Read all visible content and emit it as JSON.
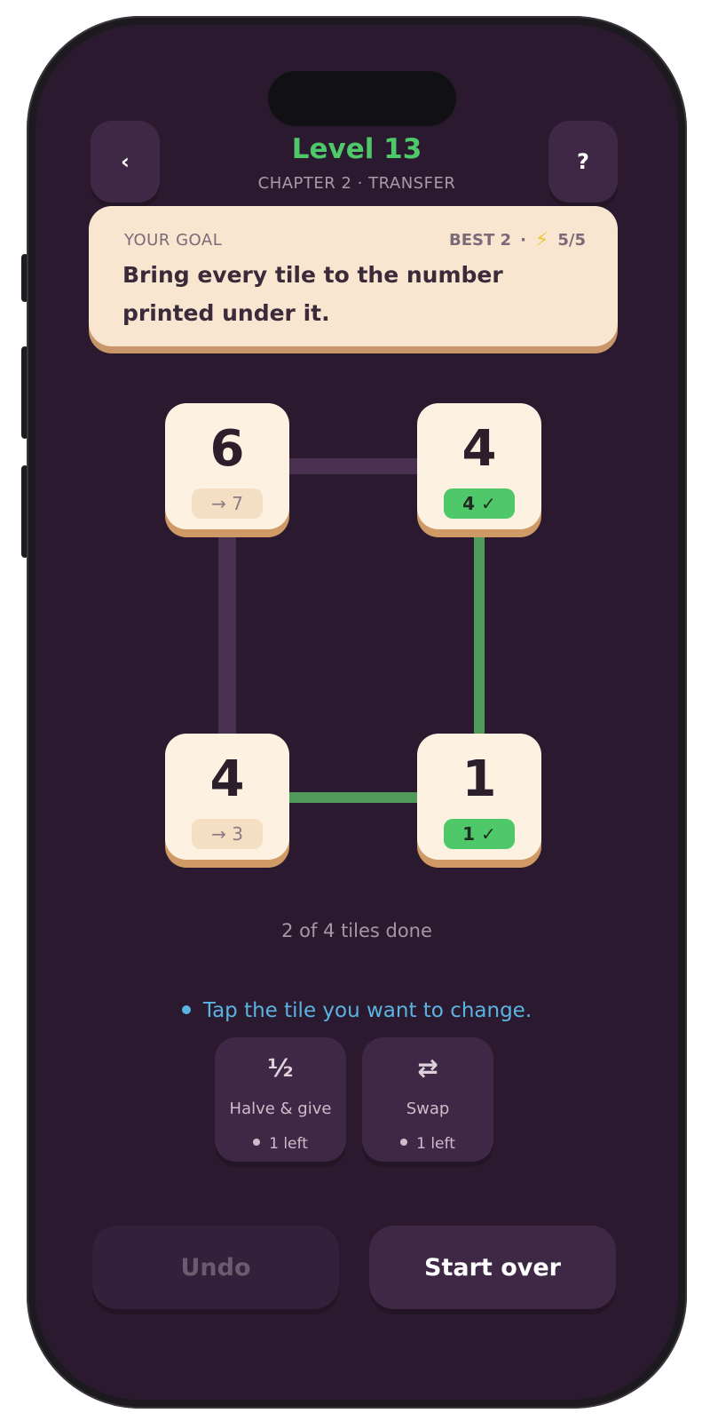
{
  "header": {
    "back_icon": "‹",
    "help_icon": "?",
    "level_title": "Level 13",
    "chapter": "CHAPTER 2 · TRANSFER"
  },
  "goal": {
    "label": "YOUR GOAL",
    "best": "BEST 2",
    "separator": "·",
    "energy_icon": "⚡",
    "energy": "5/5",
    "text": "Bring every tile to the number printed under it."
  },
  "tiles": [
    {
      "value": "6",
      "target": "→ 7",
      "status": "pending"
    },
    {
      "value": "4",
      "target": "4 ✓",
      "status": "done"
    },
    {
      "value": "4",
      "target": "→ 3",
      "status": "pending"
    },
    {
      "value": "1",
      "target": "1 ✓",
      "status": "done"
    }
  ],
  "progress_text": "2 of 4 tiles done",
  "hint": "Tap the tile you want to change.",
  "powers": [
    {
      "icon": "½",
      "label": "Halve & give",
      "count": "1 left"
    },
    {
      "icon": "⇄",
      "label": "Swap",
      "count": "1 left"
    }
  ],
  "buttons": {
    "undo": "Undo",
    "start_over": "Start over"
  },
  "colors": {
    "background": "#2b1a2f",
    "accent_green": "#4fc86a",
    "hint_blue": "#5bb3e2",
    "tile": "#fdf1e2",
    "edge_inactive": "#4a3050",
    "edge_done": "#4f9a5a"
  }
}
